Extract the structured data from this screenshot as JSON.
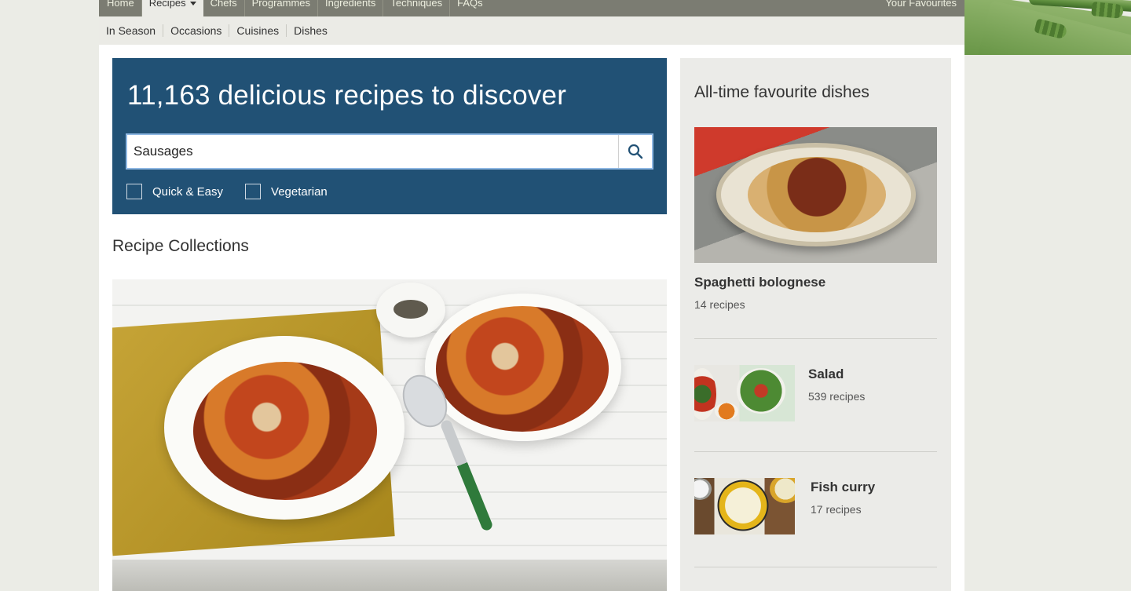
{
  "nav": {
    "items": [
      "Home",
      "Recipes",
      "Chefs",
      "Programmes",
      "Ingredients",
      "Techniques",
      "FAQs"
    ],
    "active": "Recipes",
    "right_link": "Your Favourites"
  },
  "subnav": {
    "items": [
      "In Season",
      "Occasions",
      "Cuisines",
      "Dishes"
    ]
  },
  "hero": {
    "title": "11,163 delicious recipes to discover",
    "search_value": "Sausages",
    "filters": [
      "Quick & Easy",
      "Vegetarian"
    ]
  },
  "collections": {
    "title": "Recipe Collections"
  },
  "sidebar": {
    "title": "All-time favourite dishes",
    "featured": {
      "name": "Spaghetti bolognese",
      "count": "14 recipes"
    },
    "items": [
      {
        "name": "Salad",
        "count": "539 recipes"
      },
      {
        "name": "Fish curry",
        "count": "17 recipes"
      }
    ]
  },
  "colors": {
    "hero_bg": "#215175",
    "nav_bg": "#7b7c72",
    "sidebar_bg": "#ebebe8"
  }
}
